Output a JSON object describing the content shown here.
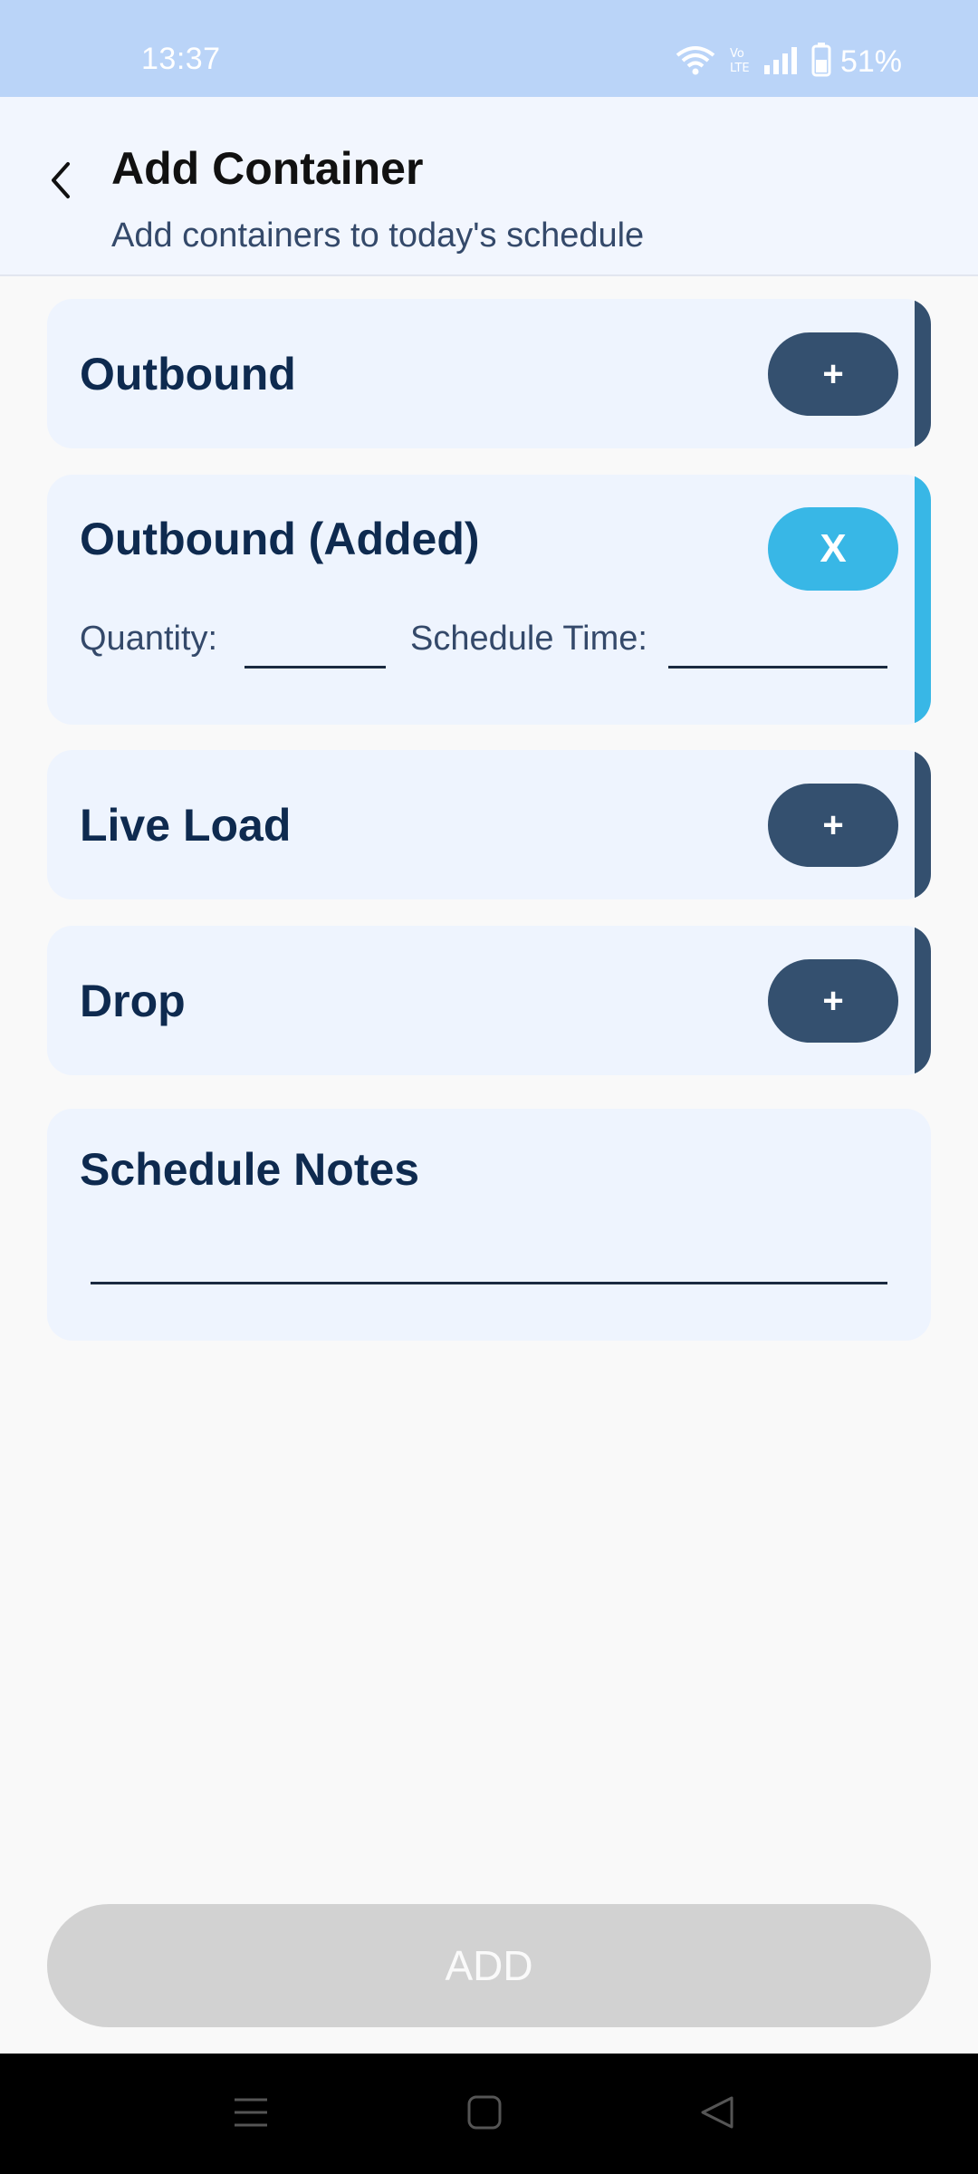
{
  "status_bar": {
    "time": "13:37",
    "battery": "51%",
    "icons": [
      "wifi-icon",
      "volte-icon",
      "signal-icon",
      "battery-icon"
    ]
  },
  "header": {
    "title": "Add Container",
    "subtitle": "Add containers to today's schedule",
    "back_icon": "chevron-left-icon"
  },
  "containers": [
    {
      "label": "Outbound",
      "action": "+",
      "accent": "#34506f"
    },
    {
      "label": "Outbound (Added)",
      "action": "X",
      "accent": "#38b7e6",
      "quantity_label": "Quantity:",
      "schedule_time_label": "Schedule Time:",
      "quantity_value": "",
      "schedule_time_value": ""
    },
    {
      "label": "Live Load",
      "action": "+",
      "accent": "#34506f"
    },
    {
      "label": "Drop",
      "action": "+",
      "accent": "#34506f"
    }
  ],
  "notes": {
    "title": "Schedule Notes",
    "value": ""
  },
  "add_button": {
    "label": "ADD"
  },
  "nav": {
    "icons": [
      "recent-apps-icon",
      "home-icon",
      "back-triangle-icon"
    ]
  },
  "colors": {
    "status_bar": "#bad4f8",
    "header_bg": "#f2f6fe",
    "card_bg": "#eef4fe",
    "primary": "#34506f",
    "accent_added": "#38b7e6",
    "title_text": "#0e2a4f",
    "disabled_button": "#d2d2d2"
  }
}
